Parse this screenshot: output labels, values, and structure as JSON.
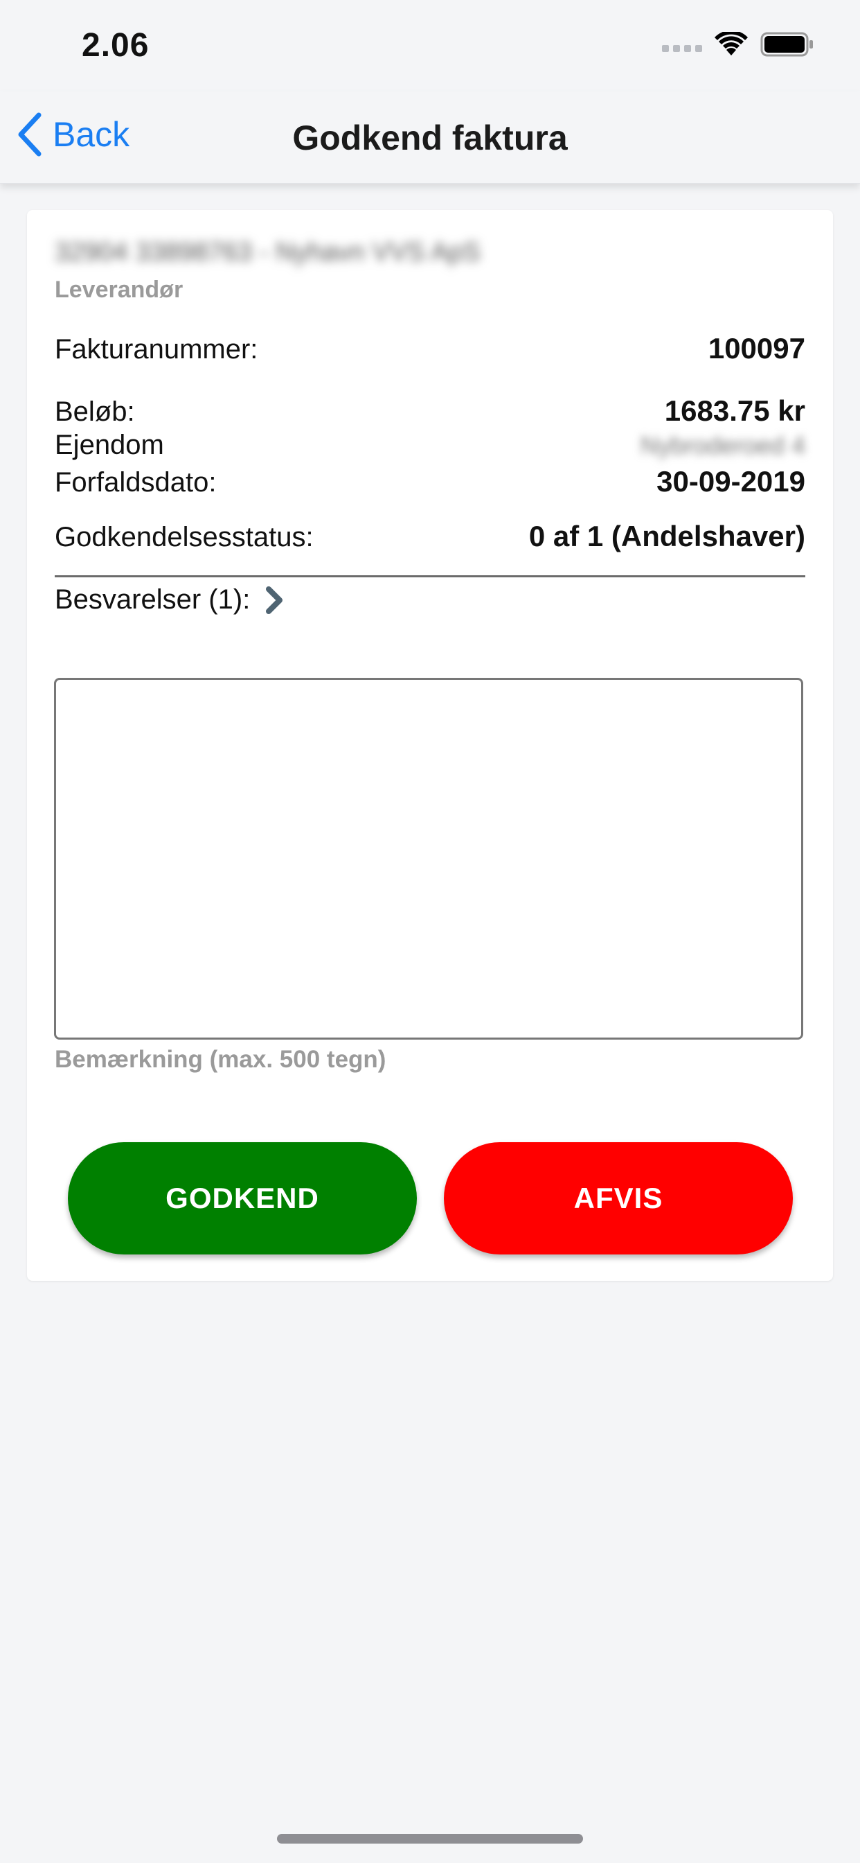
{
  "status_bar": {
    "time": "2.06"
  },
  "nav": {
    "back_label": "Back",
    "title": "Godkend faktura"
  },
  "invoice": {
    "supplier_name": "32904 33898763 - Nyhavn VVS ApS",
    "supplier_caption": "Leverandør",
    "rows": [
      {
        "label": "Fakturanummer:",
        "value": "100097"
      },
      {
        "label": "Beløb:",
        "value": "1683.75 kr"
      },
      {
        "label": "Ejendom",
        "value": "Nybroderoed 4"
      },
      {
        "label": "Forfaldsdato:",
        "value": "30-09-2019"
      },
      {
        "label": "Godkendelsesstatus:",
        "value": "0 af 1 (Andelshaver)"
      }
    ],
    "responses_label": "Besvarelser (1):",
    "remark": {
      "value": "",
      "caption": "Bemærkning (max. 500 tegn)"
    }
  },
  "actions": {
    "approve_label": "GODKEND",
    "reject_label": "AFVIS"
  },
  "colors": {
    "accent": "#1a7ef2",
    "approve": "#008000",
    "reject": "#ff0000",
    "caption": "#9a9a9a",
    "background": "#f4f5f7"
  },
  "icons": {
    "back": "chevron-left-icon",
    "responses": "chevron-right-icon",
    "wifi": "wifi-icon",
    "battery": "battery-icon",
    "signal": "cellular-signal-icon"
  }
}
